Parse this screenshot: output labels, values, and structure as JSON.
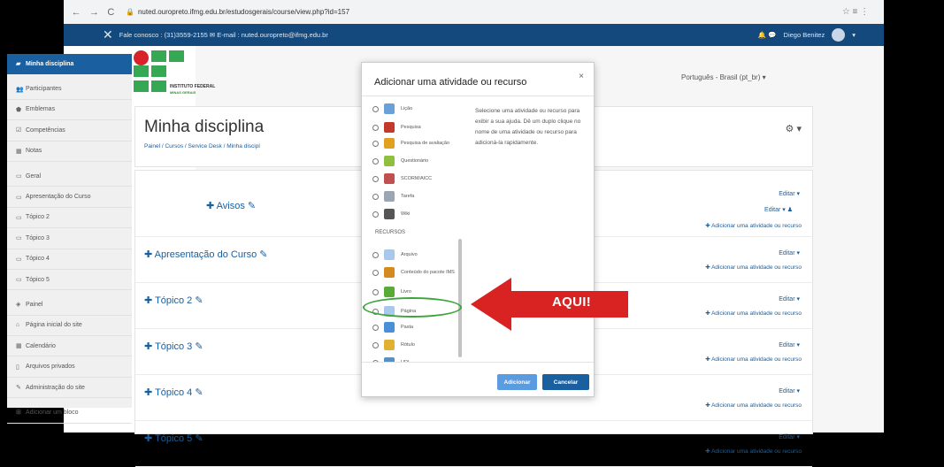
{
  "browser": {
    "back_icon": "←",
    "forward_icon": "→",
    "reload_icon": "C",
    "url": "nuted.ouropreto.ifmg.edu.br/estudosgerais/course/view.php?id=157",
    "right_icons": "☆  ≡  ⋮"
  },
  "topnav": {
    "close_icon": "✕",
    "contact": "Fale conosco : (31)3559-2155 ✉ E-mail : nuted.ouropreto@ifmg.edu.br",
    "user": "Diego Benitez",
    "icons": "🔔  💬"
  },
  "sidebar": {
    "items": [
      {
        "icon": "▰",
        "label": "Minha disciplina"
      },
      {
        "icon": "👥",
        "label": "Participantes"
      },
      {
        "icon": "⬟",
        "label": "Emblemas"
      },
      {
        "icon": "☑",
        "label": "Competências"
      },
      {
        "icon": "▦",
        "label": "Notas"
      },
      {
        "icon": "▭",
        "label": "Geral"
      },
      {
        "icon": "▭",
        "label": "Apresentação do Curso"
      },
      {
        "icon": "▭",
        "label": "Tópico 2"
      },
      {
        "icon": "▭",
        "label": "Tópico 3"
      },
      {
        "icon": "▭",
        "label": "Tópico 4"
      },
      {
        "icon": "▭",
        "label": "Tópico 5"
      },
      {
        "icon": "◈",
        "label": "Painel"
      },
      {
        "icon": "⌂",
        "label": "Página inicial do site"
      },
      {
        "icon": "▦",
        "label": "Calendário"
      },
      {
        "icon": "▯",
        "label": "Arquivos privados"
      },
      {
        "icon": "✎",
        "label": "Administração do site"
      },
      {
        "icon": "⊞",
        "label": "Adicionar um bloco"
      }
    ]
  },
  "logo": {
    "line1": "INSTITUTO FEDERAL",
    "line2": "MINAS GERAIS"
  },
  "language": "Português - Brasil (pt_br) ▾",
  "heading": {
    "title": "Minha disciplina",
    "breadcrumb": "Painel / Cursos / Service Desk / Minha discipl",
    "gear": "⚙ ▾"
  },
  "sections": [
    {
      "title": "✚  Avisos ✎",
      "edit": "Editar ▾",
      "edit2": "Editar ▾ ♟",
      "add": "✚ Adicionar uma atividade ou recurso"
    },
    {
      "title": "✚ Apresentação do Curso ✎",
      "edit": "Editar ▾",
      "add": "✚ Adicionar uma atividade ou recurso"
    },
    {
      "title": "✚ Tópico 2 ✎",
      "edit": "Editar ▾",
      "add": "✚ Adicionar uma atividade ou recurso"
    },
    {
      "title": "✚ Tópico 3 ✎",
      "edit": "Editar ▾",
      "add": "✚ Adicionar uma atividade ou recurso"
    },
    {
      "title": "✚ Tópico 4 ✎",
      "edit": "Editar ▾",
      "add": "✚ Adicionar uma atividade ou recurso"
    },
    {
      "title": "✚ Tópico 5 ✎",
      "edit": "Editar ▾",
      "add": "✚ Adicionar uma atividade ou recurso"
    }
  ],
  "modal": {
    "title": "Adicionar uma atividade ou recurso",
    "close": "×",
    "activities": [
      {
        "label": "Lição",
        "color": "#6aa0d8"
      },
      {
        "label": "Pesquisa",
        "color": "#c0392b"
      },
      {
        "label": "Pesquisa de avaliação",
        "color": "#e0a020"
      },
      {
        "label": "Questionário",
        "color": "#8fbf3f"
      },
      {
        "label": "SCORM/AICC",
        "color": "#c05050"
      },
      {
        "label": "Tarefa",
        "color": "#9aa6b2"
      },
      {
        "label": "Wiki",
        "color": "#555555"
      }
    ],
    "resources_heading": "RECURSOS",
    "resources": [
      {
        "label": "Arquivo",
        "color": "#a8c8ec"
      },
      {
        "label": "Conteúdo do pacote IMS",
        "color": "#d48a20"
      },
      {
        "label": "Livro",
        "color": "#5aaa3a"
      },
      {
        "label": "Página",
        "color": "#a8c8ec"
      },
      {
        "label": "Pasta",
        "color": "#4a90d9"
      },
      {
        "label": "Rótulo",
        "color": "#e0b030"
      },
      {
        "label": "URL",
        "color": "#5a8fc0"
      }
    ],
    "help": "Selecione uma atividade ou recurso para exibir a sua ajuda. Dê um duplo clique no nome de uma atividade ou recurso para adicioná-la rapidamente.",
    "add_button": "Adicionar",
    "cancel_button": "Cancelar"
  },
  "annotation": {
    "text": "AQUI!",
    "arrow_color": "#d92323",
    "ellipse_color": "#3aa53a"
  }
}
